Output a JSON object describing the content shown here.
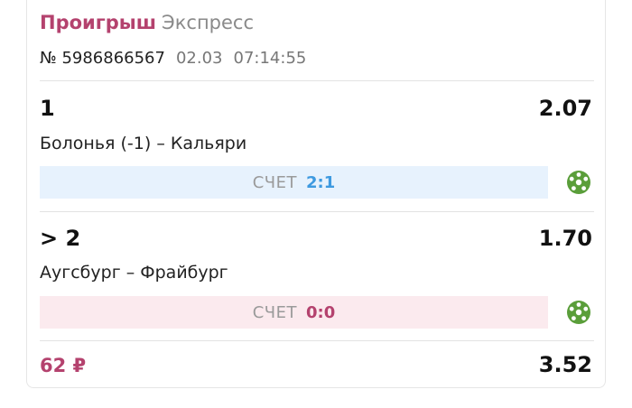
{
  "bet": {
    "status": "Проигрыш",
    "type": "Экспресс",
    "number": "№ 5986866567",
    "date": "02.03",
    "time": "07:14:55",
    "stake": "62 ₽",
    "total_odds": "3.52"
  },
  "events": [
    {
      "outcome": "1",
      "odds": "2.07",
      "match": "Болонья (-1) – Кальяри",
      "score_label": "СЧЕТ",
      "score": "2:1",
      "result": "win",
      "icon": "soccer-ball-icon"
    },
    {
      "outcome": "> 2",
      "odds": "1.70",
      "match": "Аугсбург – Фрайбург",
      "score_label": "СЧЕТ",
      "score": "0:0",
      "result": "loss",
      "icon": "soccer-ball-icon"
    }
  ],
  "colors": {
    "accent": "#b4426e",
    "win_score": "#3e9ae0",
    "win_bar": "#e7f2fd",
    "loss_bar": "#fbeaee",
    "ball": "#5a9e3a"
  }
}
